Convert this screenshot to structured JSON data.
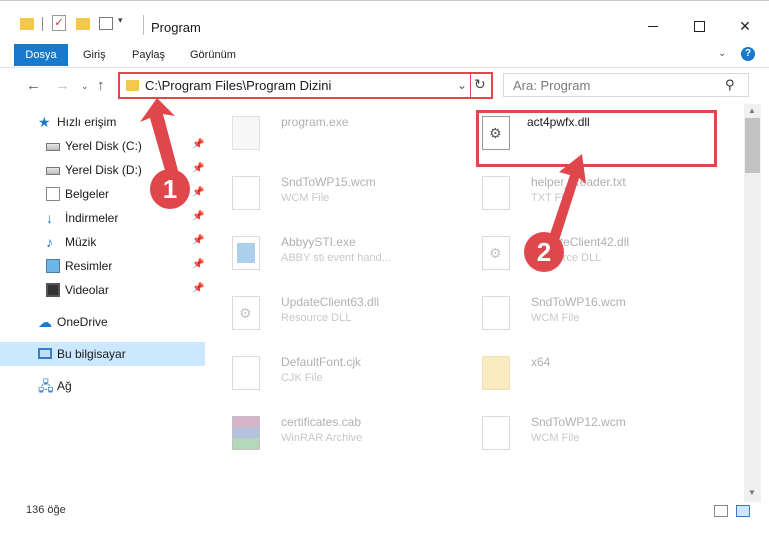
{
  "window": {
    "title": "Program",
    "minimize_glyph": "",
    "maximize_glyph": "",
    "close_glyph": "✕"
  },
  "ribbon": {
    "tabs": [
      "Dosya",
      "Giriş",
      "Paylaş",
      "Görünüm"
    ],
    "chevron_glyph": "⌄",
    "help_glyph": "?"
  },
  "nav": {
    "back_glyph": "←",
    "forward_glyph": "→",
    "recent_glyph": "⌄",
    "up_glyph": "↑",
    "address": "C:\\Program Files\\Program Dizini",
    "address_dd_glyph": "⌄",
    "refresh_glyph": "↻",
    "search_placeholder": "Ara: Program",
    "search_glyph": "⚲"
  },
  "sidebar": {
    "items": [
      {
        "label": "Hızlı erişim",
        "icon": "star-icon",
        "pinned": false
      },
      {
        "label": "Yerel Disk (C:)",
        "icon": "drive-icon",
        "pinned": true
      },
      {
        "label": "Yerel Disk (D:)",
        "icon": "drive-icon",
        "pinned": true
      },
      {
        "label": "Belgeler",
        "icon": "documents-icon",
        "pinned": true
      },
      {
        "label": "İndirmeler",
        "icon": "downloads-icon",
        "pinned": true
      },
      {
        "label": "Müzik",
        "icon": "music-icon",
        "pinned": true
      },
      {
        "label": "Resimler",
        "icon": "pictures-icon",
        "pinned": true
      },
      {
        "label": "Videolar",
        "icon": "videos-icon",
        "pinned": true
      },
      {
        "label": "OneDrive",
        "icon": "onedrive-icon",
        "pinned": false
      },
      {
        "label": "Bu bilgisayar",
        "icon": "this-pc-icon",
        "pinned": false,
        "selected": true
      },
      {
        "label": "Ağ",
        "icon": "network-icon",
        "pinned": false
      }
    ],
    "pin_glyph": "📌",
    "star_glyph": "★",
    "down_glyph": "↓",
    "music_glyph": "♪",
    "cloud_glyph": "☁",
    "net_glyph": "🖧"
  },
  "files": [
    {
      "name": "program.exe",
      "type": "",
      "icon": "exe-icon",
      "faded": true
    },
    {
      "name": "act4pwfx.dll",
      "type": "",
      "icon": "dll-gear-icon",
      "faded": false,
      "highlighted": true
    },
    {
      "name": "SndToWP15.wcm",
      "type": "WCM File",
      "icon": "file-icon",
      "faded": true
    },
    {
      "name": "helper_Reader.txt",
      "type": "TXT File",
      "icon": "file-icon",
      "faded": true
    },
    {
      "name": "AbbyySTI.exe",
      "type": "ABBY sti event hand...",
      "icon": "exe-blue-icon",
      "faded": true
    },
    {
      "name": "UpdateClient42.dll",
      "type": "Resource DLL",
      "icon": "dll-gear-icon",
      "faded": true
    },
    {
      "name": "UpdateClient63.dll",
      "type": "Resource DLL",
      "icon": "dll-gear-icon",
      "faded": true
    },
    {
      "name": "SndToWP16.wcm",
      "type": "WCM File",
      "icon": "file-icon",
      "faded": true
    },
    {
      "name": "DefaultFont.cjk",
      "type": "CJK File",
      "icon": "file-icon",
      "faded": true
    },
    {
      "name": "x64",
      "type": "",
      "icon": "folder-icon",
      "faded": true
    },
    {
      "name": "certificates.cab",
      "type": "WinRAR Archive",
      "icon": "rar-icon",
      "faded": true
    },
    {
      "name": "SndToWP12.wcm",
      "type": "WCM File",
      "icon": "file-icon",
      "faded": true
    }
  ],
  "annotations": {
    "step1": "1",
    "step2": "2",
    "accent_color": "#e0474c"
  },
  "scrollbar": {
    "up_glyph": "▲",
    "down_glyph": "▼"
  },
  "status": {
    "count": "136 öğe"
  },
  "colors": {
    "ribbon_file_tab": "#1979ca",
    "selection": "#cce8ff",
    "annotation": "#e0474c"
  }
}
